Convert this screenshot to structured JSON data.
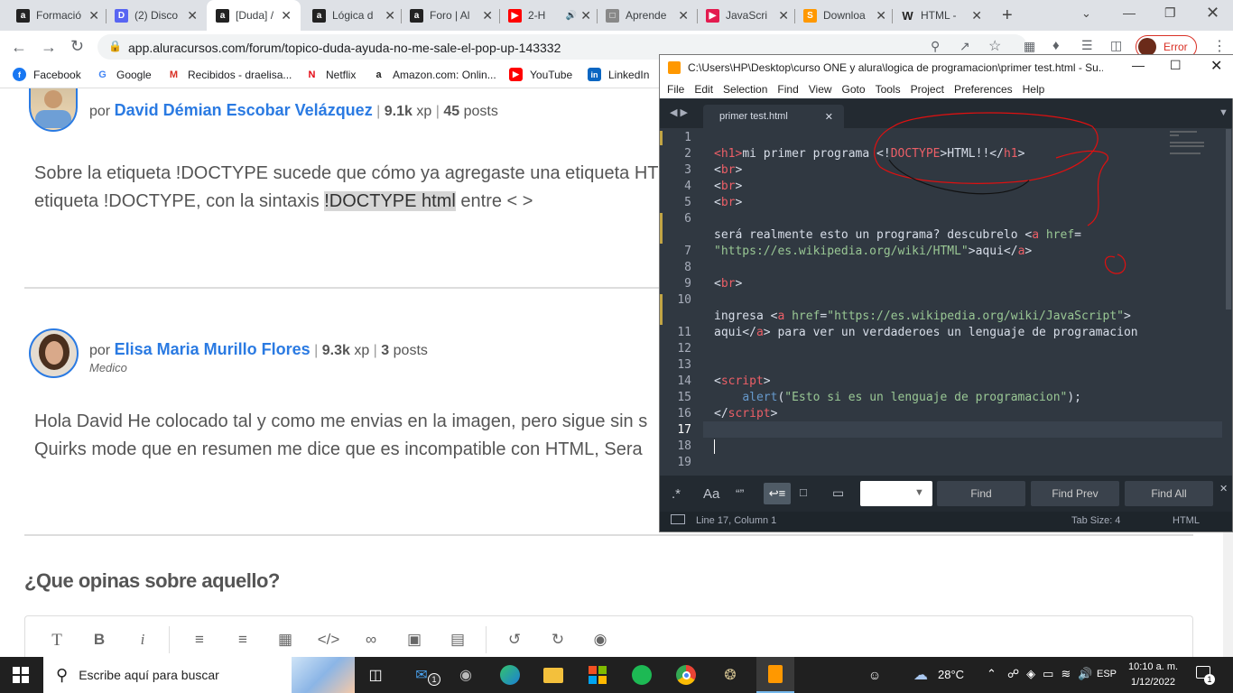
{
  "browser": {
    "tabs": [
      {
        "title": "Formació",
        "favicon": "alura-icon",
        "color": "#222"
      },
      {
        "title": "(2) Disco",
        "favicon": "discord-icon",
        "color": "#5865f2"
      },
      {
        "title": "[Duda] /",
        "favicon": "alura-icon",
        "color": "#222"
      },
      {
        "title": "Lógica d",
        "favicon": "alura-icon",
        "color": "#222"
      },
      {
        "title": "Foro | Al",
        "favicon": "alura-icon",
        "color": "#222"
      },
      {
        "title": "2-H",
        "favicon": "youtube-icon",
        "color": "#ff0000"
      },
      {
        "title": "Aprende",
        "favicon": "page-icon",
        "color": "#888"
      },
      {
        "title": "JavaScri",
        "favicon": "js-icon",
        "color": "#e31b4f"
      },
      {
        "title": "Downloa",
        "favicon": "sublime-icon",
        "color": "#ff9800"
      },
      {
        "title": "HTML -",
        "favicon": "wikipedia-icon",
        "color": "#333"
      }
    ],
    "url": "app.aluracursos.com/forum/topico-duda-ayuda-no-me-sale-el-pop-up-143332",
    "error_label": "Error",
    "bookmarks": [
      {
        "label": "Facebook",
        "icon": "facebook-icon",
        "color": "#1877f2"
      },
      {
        "label": "Google",
        "icon": "google-icon",
        "color": "#4285f4"
      },
      {
        "label": "Recibidos - draelisa...",
        "icon": "gmail-icon",
        "color": "#d93025"
      },
      {
        "label": "Netflix",
        "icon": "netflix-icon",
        "color": "#e50914"
      },
      {
        "label": "Amazon.com: Onlin...",
        "icon": "amazon-icon",
        "color": "#222"
      },
      {
        "label": "YouTube",
        "icon": "youtube-icon",
        "color": "#ff0000"
      },
      {
        "label": "LinkedIn",
        "icon": "linkedin-icon",
        "color": "#0a66c2"
      }
    ]
  },
  "forum": {
    "post1": {
      "by": "por",
      "author": "David Démian Escobar Velázquez",
      "xp_value": "9.1k",
      "xp_unit": "xp",
      "posts_value": "45",
      "posts_unit": "posts",
      "line1": "Sobre la etiqueta !DOCTYPE sucede que cómo ya agregaste una etiqueta HT",
      "line2_pre": "etiqueta !DOCTYPE, con la sintaxis ",
      "line2_hl": "!DOCTYPE html",
      "line2_post": " entre < >"
    },
    "post2": {
      "by": "por",
      "author": "Elisa Maria Murillo Flores",
      "xp_value": "9.3k",
      "xp_unit": "xp",
      "posts_value": "3",
      "posts_unit": "posts",
      "role": "Medico",
      "line1": "Hola David He colocado tal y como me envias en la imagen, pero sigue sin s",
      "line2": "Quirks mode que en resumen me dice que es incompatible con HTML, Sera"
    },
    "reply_heading": "¿Que opinas sobre aquello?",
    "pipe": "|"
  },
  "sublime": {
    "title": "C:\\Users\\HP\\Desktop\\curso ONE y alura\\logica de programacion\\primer test.html - Su...",
    "menu": [
      "File",
      "Edit",
      "Selection",
      "Find",
      "View",
      "Goto",
      "Tools",
      "Project",
      "Preferences",
      "Help"
    ],
    "tab_name": "primer test.html",
    "line_numbers": [
      "1",
      "2",
      "3",
      "4",
      "5",
      "6",
      "",
      "7",
      "8",
      "9",
      "10",
      "",
      "11",
      "12",
      "13",
      "14",
      "15",
      "16",
      "17",
      "18",
      "19"
    ],
    "find_buttons": [
      "Find",
      "Find Prev",
      "Find All"
    ],
    "find_toggles": [
      ".*",
      "Aa",
      "“”"
    ],
    "status_left": "Line 17, Column 1",
    "status_tab": "Tab Size: 4",
    "status_syntax": "HTML"
  },
  "taskbar": {
    "search_placeholder": "Escribe aquí para buscar",
    "weather": "28°C",
    "lang": "ESP",
    "time": "10:10 a. m.",
    "date": "1/12/2022",
    "mail_badge": "1",
    "notif_badge": "1"
  }
}
